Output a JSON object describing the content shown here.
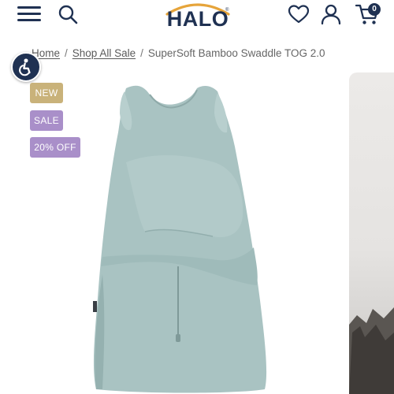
{
  "header": {
    "logo_text": "HALO",
    "logo_reg": "®",
    "cart_count": "0",
    "icons": {
      "menu": "hamburger-menu-icon",
      "search": "search-icon",
      "wishlist": "heart-icon",
      "account": "user-icon",
      "cart": "cart-icon"
    }
  },
  "breadcrumb": {
    "items": [
      "Home",
      "Shop All Sale"
    ],
    "separator": "/",
    "current": "SuperSoft Bamboo Swaddle TOG 2.0"
  },
  "accessibility": {
    "icon": "accessibility-icon"
  },
  "badges": {
    "new": "NEW",
    "sale": "SALE",
    "discount": "20% OFF"
  },
  "colors": {
    "brand_navy": "#1f3152",
    "badge_gold": "#c9b27a",
    "badge_purple": "#a98fc9",
    "swaddle_color": "#a9c3c2"
  }
}
